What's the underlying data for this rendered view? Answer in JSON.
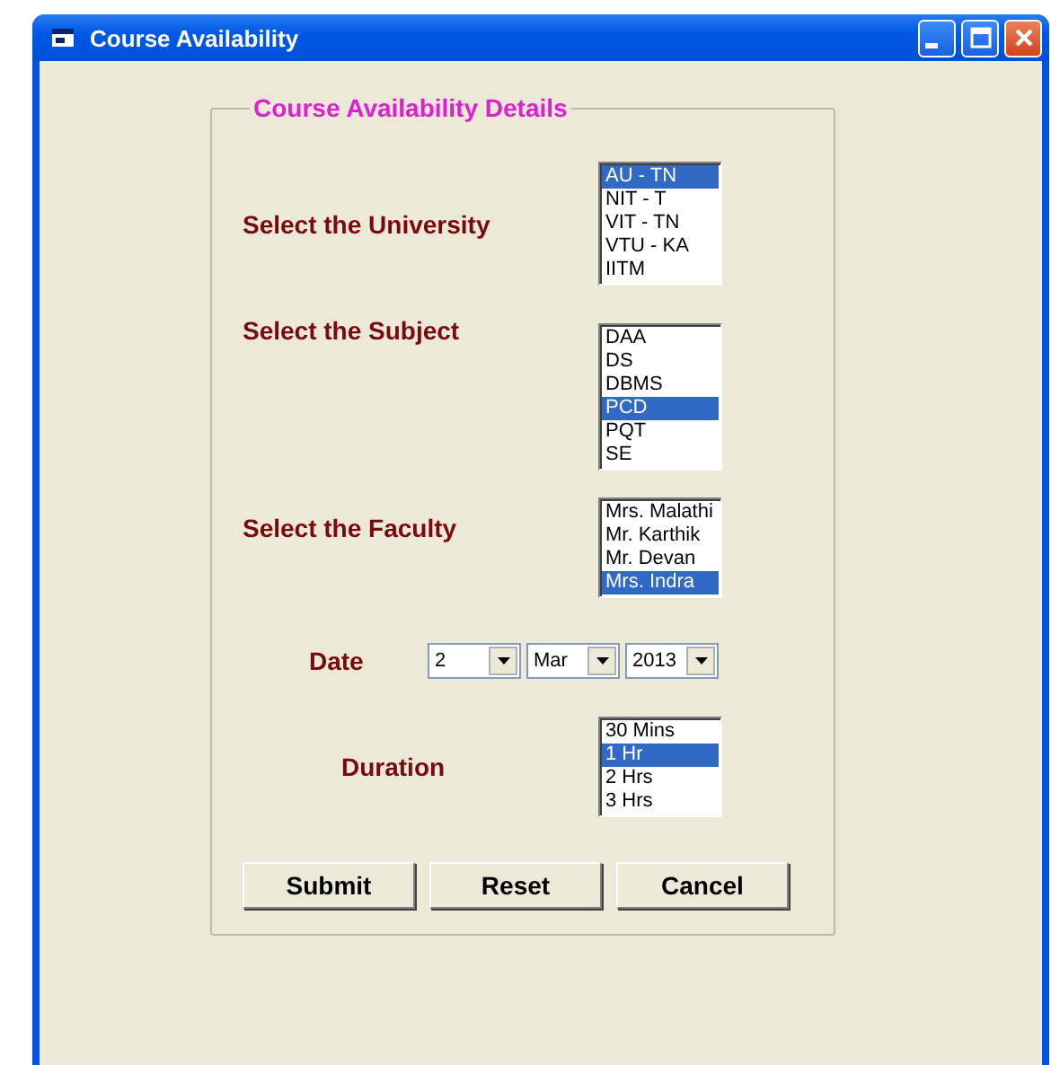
{
  "window": {
    "title": "Course Availability"
  },
  "group": {
    "title": "Course Availability Details"
  },
  "fields": [
    {
      "kind": "listbox",
      "label": "Select the University",
      "items": [
        {
          "text": "AU - TN",
          "selected": true
        },
        {
          "text": "NIT - T",
          "selected": false
        },
        {
          "text": "VIT - TN",
          "selected": false
        },
        {
          "text": "VTU - KA",
          "selected": false
        },
        {
          "text": "IITM",
          "selected": false
        }
      ]
    },
    {
      "kind": "listbox",
      "label": "Select the Subject",
      "items": [
        {
          "text": "DAA",
          "selected": false
        },
        {
          "text": "DS",
          "selected": false
        },
        {
          "text": "DBMS",
          "selected": false
        },
        {
          "text": "PCD",
          "selected": true
        },
        {
          "text": "PQT",
          "selected": false
        },
        {
          "text": "SE",
          "selected": false
        }
      ]
    },
    {
      "kind": "listbox",
      "label": "Select the Faculty",
      "items": [
        {
          "text": "Mrs. Malathi",
          "selected": false
        },
        {
          "text": "Mr. Karthik",
          "selected": false
        },
        {
          "text": "Mr. Devan",
          "selected": false
        },
        {
          "text": "Mrs. Indra",
          "selected": true
        }
      ]
    },
    {
      "kind": "date",
      "label": "Date",
      "combos": [
        "2",
        "Mar",
        "2013"
      ]
    },
    {
      "kind": "listbox",
      "label": "Duration",
      "items": [
        {
          "text": "30 Mins",
          "selected": false
        },
        {
          "text": "1 Hr",
          "selected": true
        },
        {
          "text": "2 Hrs",
          "selected": false
        },
        {
          "text": "3 Hrs",
          "selected": false
        }
      ]
    }
  ],
  "buttons": [
    "Submit",
    "Reset",
    "Cancel"
  ]
}
